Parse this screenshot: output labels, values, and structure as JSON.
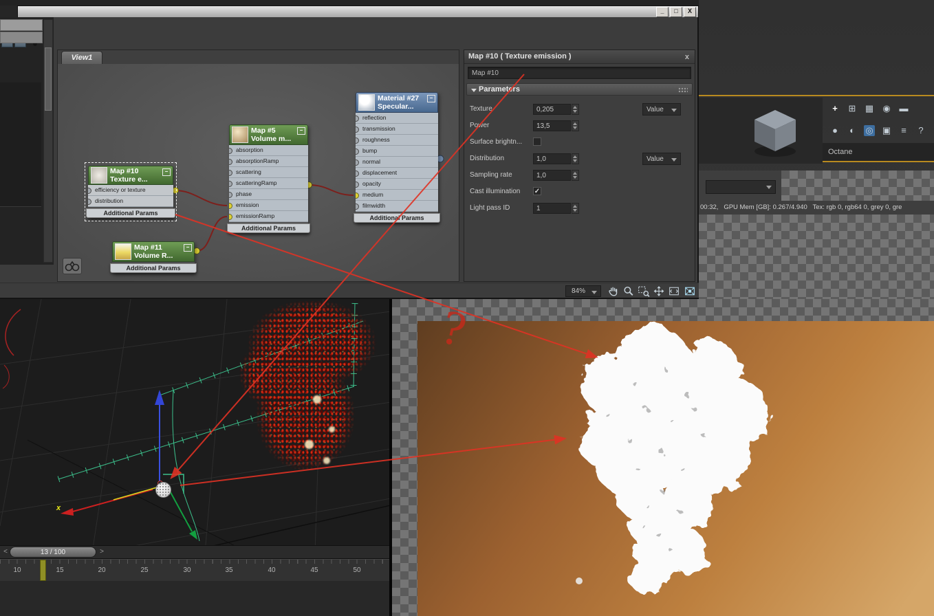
{
  "editor_window": {
    "controls": {
      "minimize": "_",
      "maximize": "□",
      "close": "X"
    },
    "toolbar": {
      "view_selector": "View 1"
    },
    "node_view": {
      "tab": "View1",
      "nodes": {
        "map10": {
          "title": "Map #10",
          "subtitle": "Texture e...",
          "collapse": "−",
          "slots": [
            "efficiency or texture",
            "distribution"
          ],
          "footer": "Additional Params"
        },
        "map5": {
          "title": "Map #5",
          "subtitle": "Volume m...",
          "collapse": "−",
          "slots": [
            "absorption",
            "absorptionRamp",
            "scattering",
            "scatteringRamp",
            "phase",
            "emission",
            "emissionRamp"
          ],
          "footer": "Additional Params"
        },
        "mat27": {
          "title": "Material #27",
          "subtitle": "Specular...",
          "collapse": "−",
          "slots": [
            "reflection",
            "transmission",
            "roughness",
            "bump",
            "normal",
            "displacement",
            "opacity",
            "medium",
            "filmwidth"
          ],
          "footer": "Additional Params"
        },
        "map11": {
          "title": "Map #11",
          "subtitle": "Volume R...",
          "collapse": "−",
          "footer": "Additional Params"
        }
      }
    },
    "params": {
      "title": "Map #10  ( Texture emission )",
      "close": "x",
      "name_value": "Map #10",
      "rollout": "Parameters",
      "check_glyph": "✓",
      "rows": [
        {
          "label": "Texture",
          "value": "0,205",
          "combo": "Value"
        },
        {
          "label": "Power",
          "value": "13,5"
        },
        {
          "label": "Surface brightn...",
          "checked": false
        },
        {
          "label": "Distribution",
          "value": "1,0",
          "combo": "Value"
        },
        {
          "label": "Sampling rate",
          "value": "1,0"
        },
        {
          "label": "Cast illumination",
          "checked": true
        },
        {
          "label": "Light pass ID",
          "value": "1"
        }
      ]
    },
    "statusbar": {
      "zoom": "84%"
    }
  },
  "viewport": {
    "time_slider": {
      "prev": "<",
      "label": "13 / 100",
      "next": ">"
    },
    "ruler_ticks": [
      "10",
      "15",
      "20",
      "25",
      "30",
      "35",
      "40",
      "45",
      "50"
    ],
    "axis_label": "x"
  },
  "octane_panel": {
    "label": "Octane",
    "toolbar_row1": [
      "+",
      "⊞",
      "▦",
      "◉",
      "▬"
    ],
    "toolbar_row2": [
      "●",
      "◐",
      "◎",
      "▣",
      "≡",
      "?"
    ],
    "status": "00:32,   GPU Mem [GB]: 0.267/4.940   Tex: rgb 0, rgb64 0, grey 0, gre"
  },
  "annotation": {
    "question_mark": "?"
  },
  "colors": {
    "annotation_red": "#e03224",
    "wire_red": "#7d1f1b",
    "connected_socket": "#ddd035",
    "header_green": "#4e7a3c",
    "header_blue": "#50709c",
    "render_orange": "#b97b3c"
  }
}
